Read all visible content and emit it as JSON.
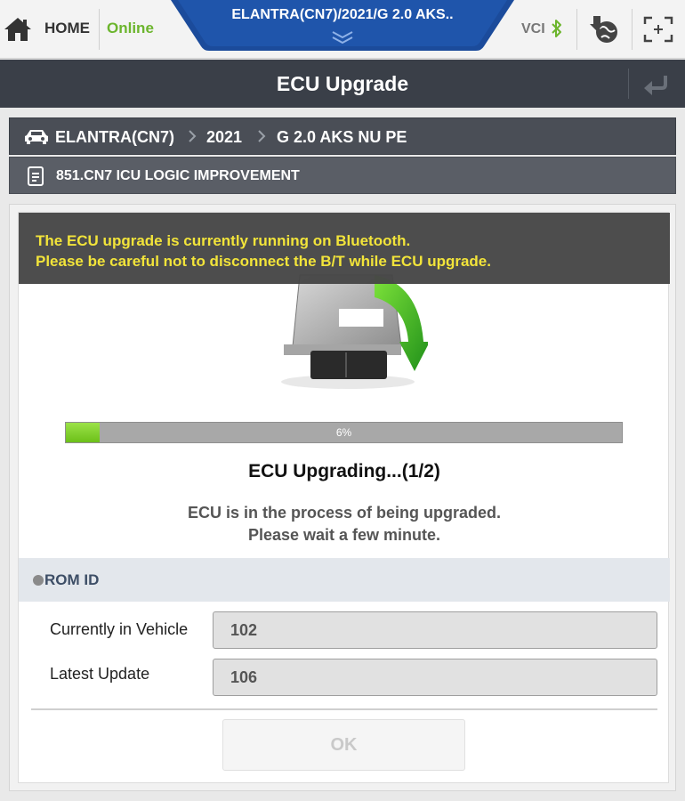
{
  "topbar": {
    "home_label": "HOME",
    "connection_status": "Online",
    "vehicle_title": "ELANTRA(CN7)/2021/G 2.0 AKS..",
    "vci_label": "VCI"
  },
  "page": {
    "title": "ECU Upgrade"
  },
  "breadcrumb": {
    "items": [
      "ELANTRA(CN7)",
      "2021",
      "G 2.0 AKS NU PE"
    ]
  },
  "logic_item": {
    "label": "851.CN7 ICU LOGIC IMPROVEMENT"
  },
  "warning": {
    "line1": "The ECU upgrade is currently running on Bluetooth.",
    "line2": "Please be careful not to disconnect the B/T while ECU upgrade."
  },
  "progress": {
    "percent": 6,
    "text": "6%"
  },
  "status": {
    "title": "ECU Upgrading...(1/2)",
    "message_line1": "ECU is in the process of being upgraded.",
    "message_line2": "Please wait a few minute."
  },
  "rom_id": {
    "header": "ROM ID",
    "rows": [
      {
        "label": "Currently in Vehicle",
        "value": "102"
      },
      {
        "label": "Latest Update",
        "value": "106"
      }
    ]
  },
  "actions": {
    "ok_label": "OK"
  },
  "colors": {
    "online": "#6cb52d",
    "vehicle_tab": "#1b4b9b",
    "warning_text": "#f2e43a",
    "progress_fill": "#7ed12a"
  }
}
